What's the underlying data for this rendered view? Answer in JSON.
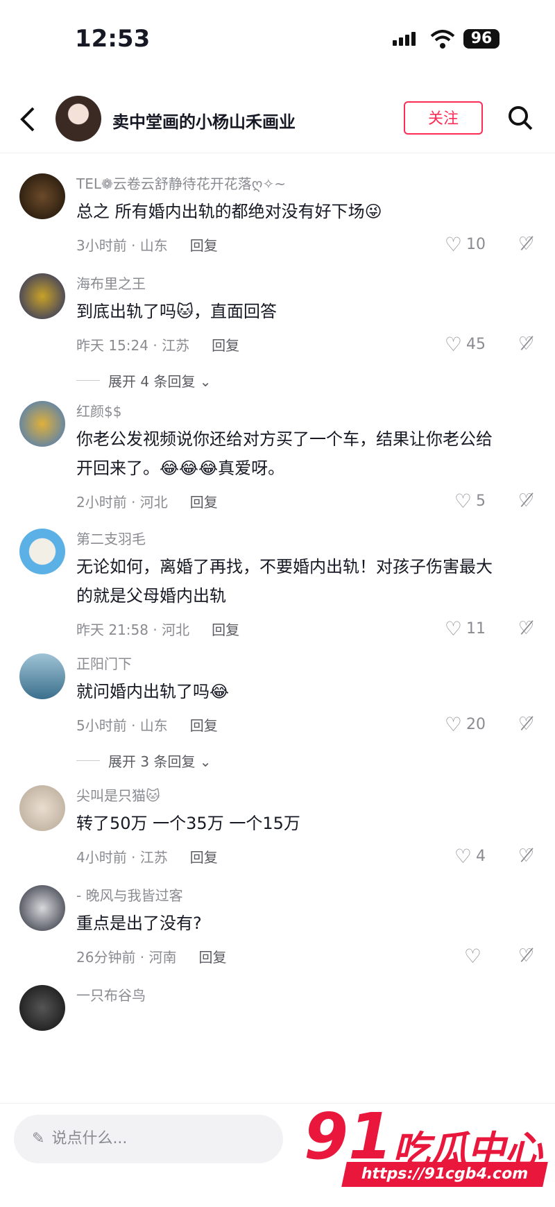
{
  "status": {
    "time": "12:53",
    "battery": "96"
  },
  "header": {
    "title": "卖中堂画的小杨山禾画业",
    "follow": "关注"
  },
  "comments": [
    {
      "user": "TEL❁云卷云舒静待花开花落ღ✧~",
      "text": "总之 所有婚内出轨的都绝对没有好下场😜",
      "time": "3小时前 · 山东",
      "reply": "回复",
      "likes": "10"
    },
    {
      "user": "海布里之王",
      "text": "到底出轨了吗🐱，直面回答",
      "time": "昨天 15:24 · 江苏",
      "reply": "回复",
      "likes": "45",
      "expand": "展开 4 条回复 ⌄"
    },
    {
      "user": "红颜$$",
      "text": "你老公发视频说你还给对方买了一个车，结果让你老公给开回来了。😂😂😂真爱呀。",
      "time": "2小时前 · 河北",
      "reply": "回复",
      "likes": "5"
    },
    {
      "user": "第二支羽毛",
      "text": "无论如何，离婚了再找，不要婚内出轨！对孩子伤害最大的就是父母婚内出轨",
      "time": "昨天 21:58 · 河北",
      "reply": "回复",
      "likes": "11"
    },
    {
      "user": "正阳门下",
      "text": "就问婚内出轨了吗😂",
      "time": "5小时前 · 山东",
      "reply": "回复",
      "likes": "20",
      "expand": "展开 3 条回复 ⌄"
    },
    {
      "user": "尖叫是只猫🐱",
      "text": "转了50万 一个35万 一个15万",
      "time": "4小时前 · 江苏",
      "reply": "回复",
      "likes": "4"
    },
    {
      "user": "- 晚风与我皆过客",
      "text": "重点是出了没有?",
      "time": "26分钟前 · 河南",
      "reply": "回复",
      "likes": ""
    },
    {
      "user": "一只布谷鸟",
      "text": "",
      "time": "",
      "reply": "",
      "likes": ""
    }
  ],
  "bottom": {
    "placeholder": "说点什么..."
  },
  "watermark": {
    "num": "91",
    "name": "吃瓜中心",
    "url": "https://91cgb4.com"
  }
}
